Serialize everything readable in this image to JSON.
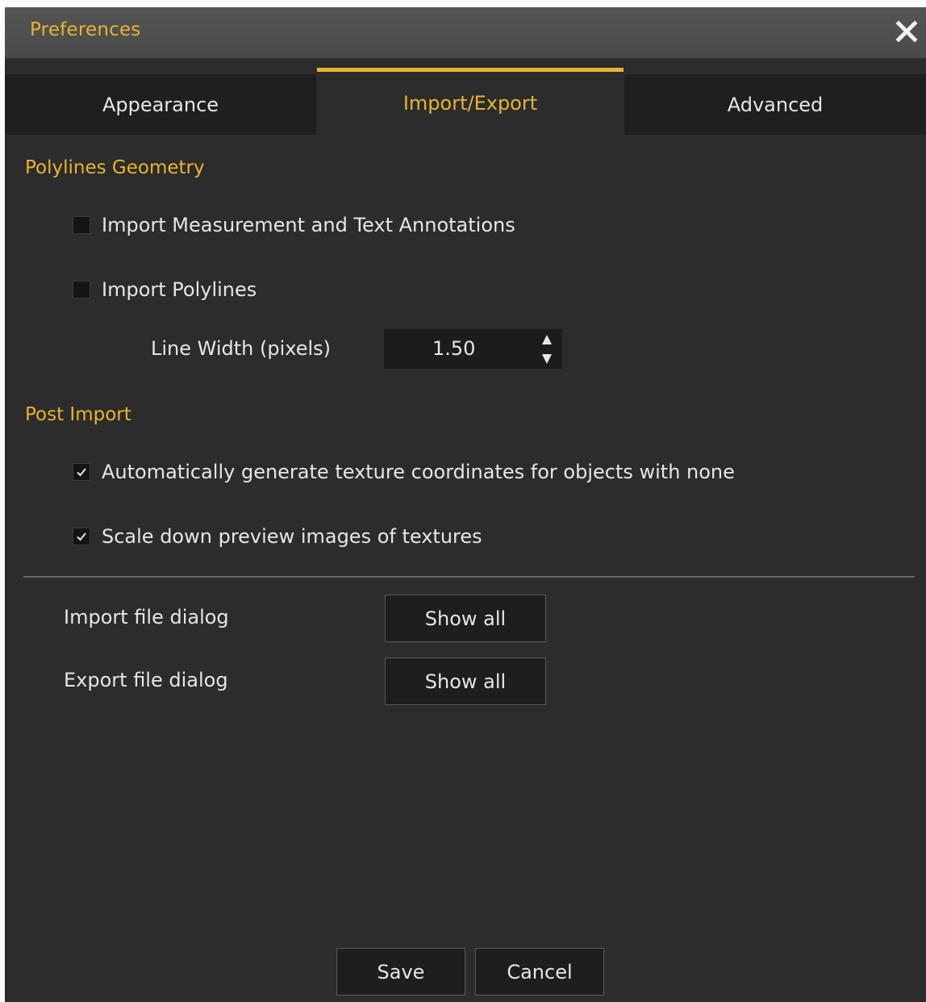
{
  "window": {
    "title": "Preferences",
    "accent_color": "#e8b430"
  },
  "tabs": [
    {
      "label": "Appearance",
      "active": false
    },
    {
      "label": "Import/Export",
      "active": true
    },
    {
      "label": "Advanced",
      "active": false
    }
  ],
  "polylines": {
    "title": "Polylines Geometry",
    "import_annotations": {
      "label": "Import Measurement and Text Annotations",
      "checked": false
    },
    "import_polylines": {
      "label": "Import Polylines",
      "checked": false
    },
    "line_width": {
      "label": "Line Width (pixels)",
      "value": "1.50"
    }
  },
  "post_import": {
    "title": "Post Import",
    "auto_texcoords": {
      "label": "Automatically generate texture coordinates for objects with none",
      "checked": true
    },
    "scale_previews": {
      "label": "Scale down preview images of textures",
      "checked": true
    }
  },
  "dialogs": {
    "import": {
      "label": "Import file dialog",
      "button": "Show all"
    },
    "export": {
      "label": "Export file dialog",
      "button": "Show all"
    }
  },
  "footer": {
    "save": "Save",
    "cancel": "Cancel"
  },
  "icons": {
    "close": "close-icon",
    "check": "checkmark-icon",
    "spin": "spin-arrows-icon"
  }
}
